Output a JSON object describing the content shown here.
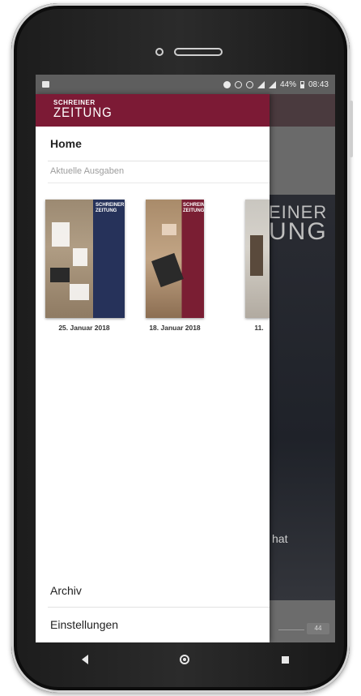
{
  "status_bar": {
    "battery": "44%",
    "time": "08:43"
  },
  "app": {
    "logo_line1": "SCHREINER",
    "logo_line2": "ZEITUNG",
    "brand_color": "#7c1a35"
  },
  "drawer": {
    "home_label": "Home",
    "section_label": "Aktuelle Ausgaben",
    "issues": [
      {
        "date": "25. Januar 2018"
      },
      {
        "date": "18. Januar 2018"
      },
      {
        "date": "11."
      }
    ],
    "archiv_label": "Archiv",
    "settings_label": "Einstellungen"
  },
  "background": {
    "cover_title_line1": "EINER",
    "cover_title_line2": "UNG",
    "cover_text": "hat",
    "pill_text": "44"
  }
}
